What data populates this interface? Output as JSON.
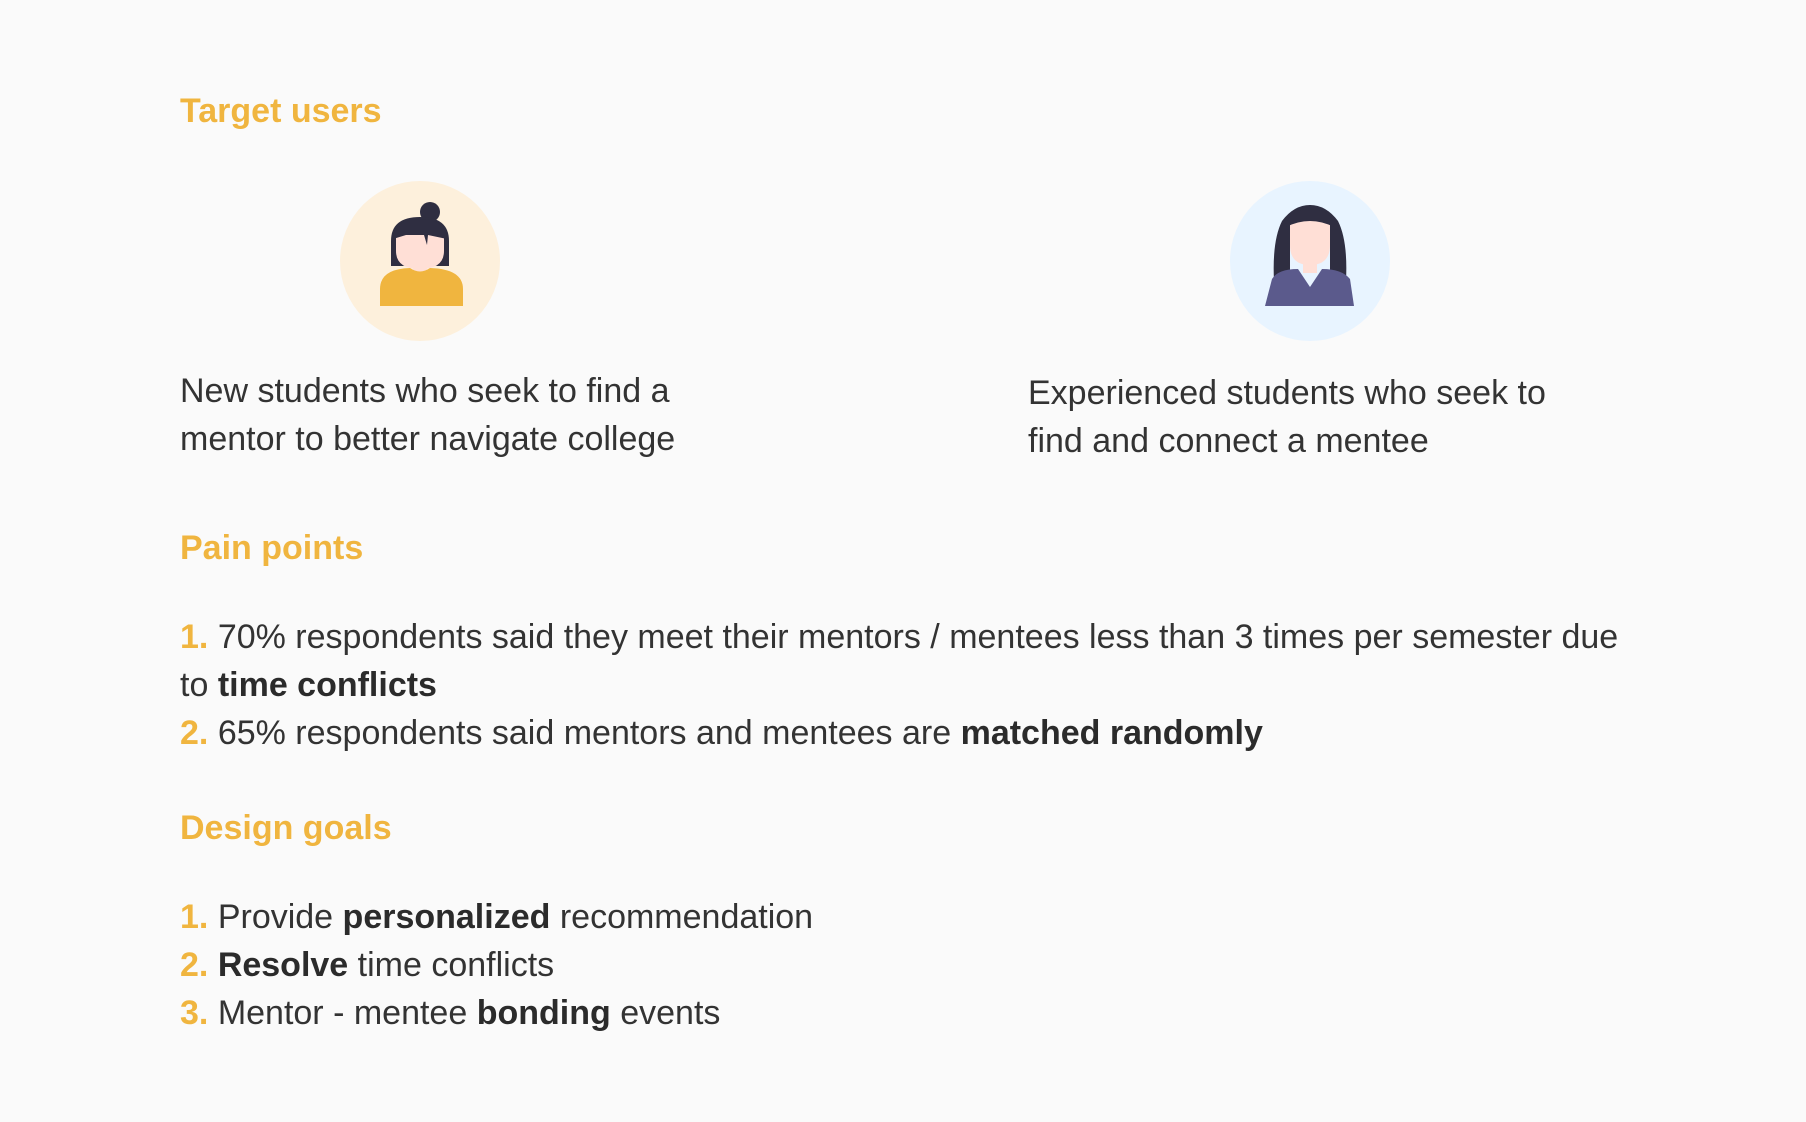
{
  "target_users": {
    "heading": "Target users",
    "mentee": {
      "icon": "young-woman-avatar-icon",
      "description": "New students who seek to find a mentor to better navigate college"
    },
    "mentor": {
      "icon": "woman-avatar-icon",
      "description": "Experienced students who seek to find and connect a mentee"
    }
  },
  "pain_points": {
    "heading": "Pain points",
    "items": [
      {
        "number": "1.",
        "text_before": "70% respondents said they meet their mentors / mentees less than 3 times per semester due to ",
        "bold": "time conflicts",
        "text_after": ""
      },
      {
        "number": "2.",
        "text_before": "65% respondents said mentors and mentees are ",
        "bold": "matched randomly",
        "text_after": ""
      }
    ]
  },
  "design_goals": {
    "heading": "Design goals",
    "items": [
      {
        "number": "1.",
        "text_before": "Provide ",
        "bold": "personalized",
        "text_after": " recommendation"
      },
      {
        "number": "2.",
        "text_before": "",
        "bold": "Resolve",
        "text_after": " time conflicts"
      },
      {
        "number": "3.",
        "text_before": "Mentor - mentee ",
        "bold": "bonding",
        "text_after": " events"
      }
    ]
  },
  "colors": {
    "background": "#fafafa",
    "accent": "#f0b53f",
    "text": "#333333",
    "mentee_circle": "#fdf0dc",
    "mentor_circle": "#e8f4ff",
    "mentee_shirt": "#f0b53f",
    "mentor_shirt": "#5b5a8c",
    "hair": "#2f2e41",
    "skin": "#ffdfd6"
  }
}
